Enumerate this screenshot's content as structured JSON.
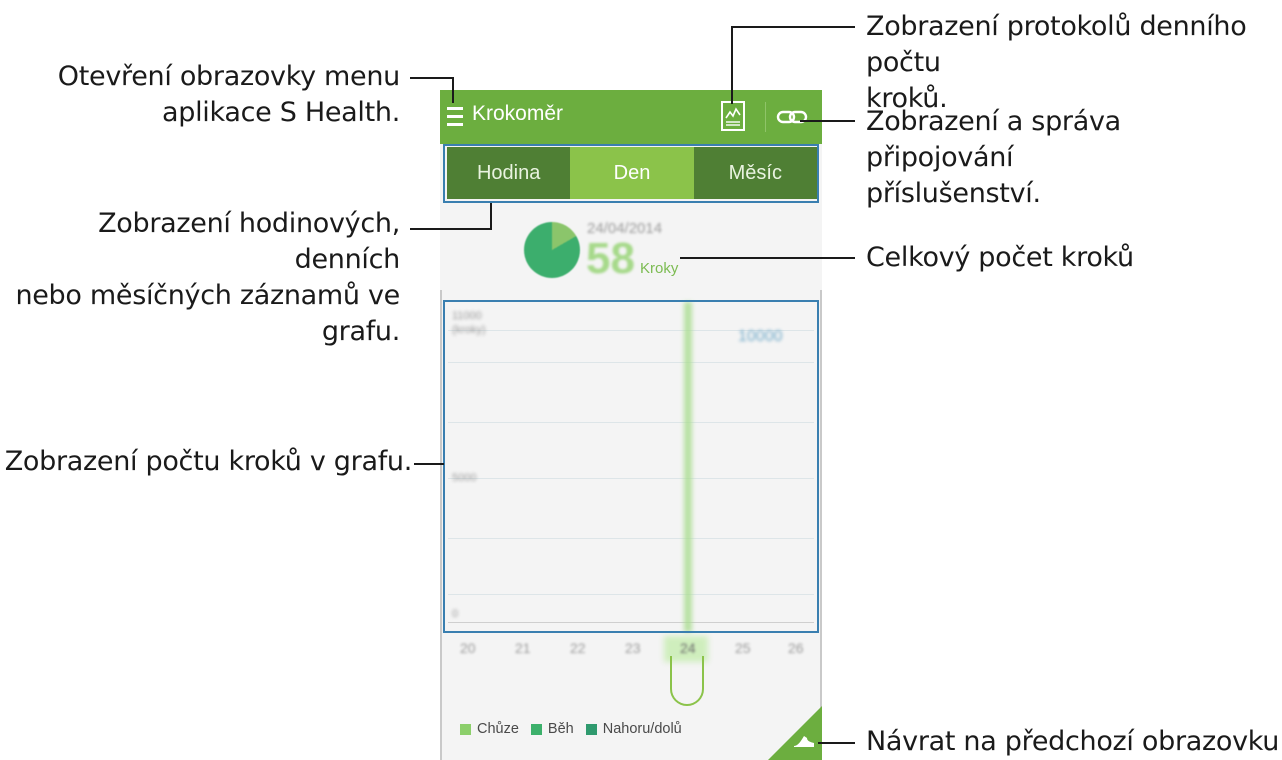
{
  "app": {
    "title": "Krokoměr",
    "accent_color": "#6cae3f",
    "icons": {
      "menu": "hamburger-menu-icon",
      "log": "daily-log-icon",
      "accessory": "link-icon",
      "back": "shoe-icon"
    }
  },
  "tabs": [
    {
      "label": "Hodina",
      "active": false
    },
    {
      "label": "Den",
      "active": true
    },
    {
      "label": "Měsíc",
      "active": false
    }
  ],
  "summary": {
    "date": "24/04/2014",
    "steps": "58",
    "unit": "Kroky"
  },
  "graph": {
    "y_labels": [
      "11000",
      "(kroky)",
      "5000",
      "0"
    ],
    "goal": "10000",
    "x_labels": [
      "20",
      "21",
      "22",
      "23",
      "24",
      "25",
      "26"
    ],
    "selected_x": "24"
  },
  "legend": [
    {
      "label": "Chůze",
      "color": "#8ccf6b"
    },
    {
      "label": "Běh",
      "color": "#3cb06b"
    },
    {
      "label": "Nahoru/dolů",
      "color": "#2f9a6e"
    }
  ],
  "callouts": {
    "menu": "Otevření obrazovky menu aplikace S Health.",
    "menu_line1": "Otevření obrazovky menu",
    "menu_line2": "aplikace S Health.",
    "log_line1": "Zobrazení protokolů denního počtu",
    "log_line2": "kroků.",
    "accessory_line1": "Zobrazení a správa připojování",
    "accessory_line2": "příslušenství.",
    "tabs_line1": "Zobrazení hodinových, denních",
    "tabs_line2": "nebo měsíčných záznamů ve",
    "tabs_line3": "grafu.",
    "total": "Celkový počet kroků",
    "graph": "Zobrazení počtu kroků v grafu.",
    "back": "Návrat na předchozí obrazovku."
  }
}
